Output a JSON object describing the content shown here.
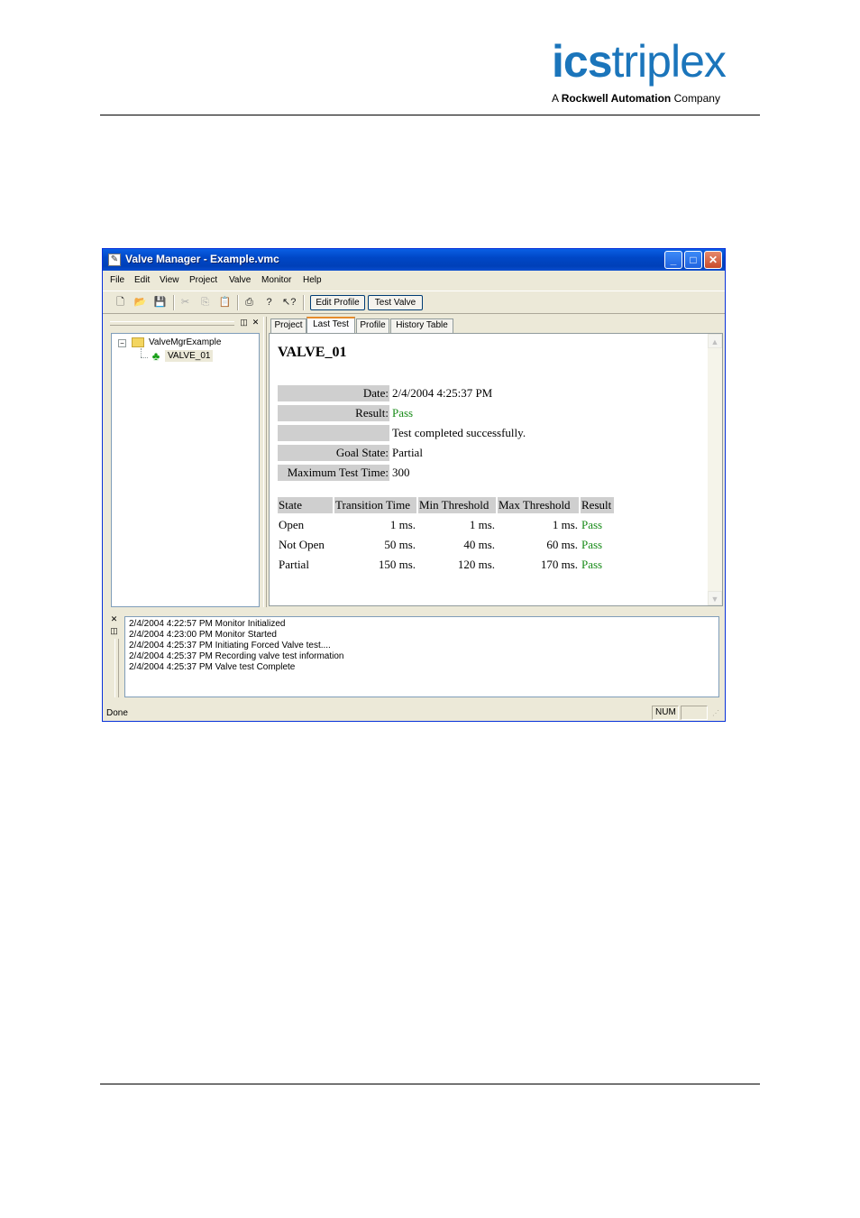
{
  "page": {
    "logo": {
      "brand_bold": "ics",
      "brand_light": "triplex",
      "tagline_prefix": "A ",
      "tagline_bold": "Rockwell Automation",
      "tagline_suffix": " Company"
    },
    "colors": {
      "logo_blue": "#1b75bb",
      "pass_green": "#168a16",
      "titlebar_blue": "#0047c6"
    }
  },
  "window": {
    "title": "Valve Manager - Example.vmc",
    "controls": {
      "minimize": "_",
      "maximize": "□",
      "close": "✕"
    },
    "menu": [
      "File",
      "Edit",
      "View",
      "Project",
      "Valve",
      "Monitor",
      "Help"
    ],
    "toolbar": {
      "icons": [
        "new-file-icon",
        "open-folder-icon",
        "save-icon",
        "cut-icon",
        "copy-icon",
        "paste-icon",
        "print-icon",
        "help-icon",
        "context-help-icon"
      ],
      "edit_profile": "Edit Profile",
      "test_valve": "Test Valve"
    },
    "tree": {
      "root": "ValveMgrExample",
      "child": "VALVE_01"
    },
    "tabs": [
      "Project",
      "Last Test",
      "Profile",
      "History Table"
    ],
    "active_tab": "Last Test",
    "last_test": {
      "valve_name": "VALVE_01",
      "fields": [
        {
          "label": "Date:",
          "value": "2/4/2004 4:25:37 PM"
        },
        {
          "label": "Result:",
          "value": "Pass"
        },
        {
          "label": "",
          "value": "Test completed successfully."
        },
        {
          "label": "Goal State:",
          "value": "Partial"
        },
        {
          "label": "Maximum Test Time:",
          "value": "300"
        }
      ],
      "states": {
        "headers": [
          "State",
          "Transition Time",
          "Min Threshold",
          "Max Threshold",
          "Result"
        ],
        "rows": [
          {
            "state": "Open",
            "transition": "1 ms.",
            "min": "1 ms.",
            "max": "1 ms.",
            "result": "Pass"
          },
          {
            "state": "Not Open",
            "transition": "50 ms.",
            "min": "40 ms.",
            "max": "60 ms.",
            "result": "Pass"
          },
          {
            "state": "Partial",
            "transition": "150 ms.",
            "min": "120 ms.",
            "max": "170 ms.",
            "result": "Pass"
          }
        ]
      }
    },
    "output": [
      "2/4/2004 4:22:57 PM Monitor Initialized",
      "2/4/2004 4:23:00 PM Monitor Started",
      "2/4/2004 4:25:37 PM Initiating Forced Valve test....",
      "2/4/2004 4:25:37 PM Recording valve test information",
      "2/4/2004 4:25:37 PM Valve test Complete"
    ],
    "status": {
      "message": "Done",
      "num": "NUM"
    }
  }
}
